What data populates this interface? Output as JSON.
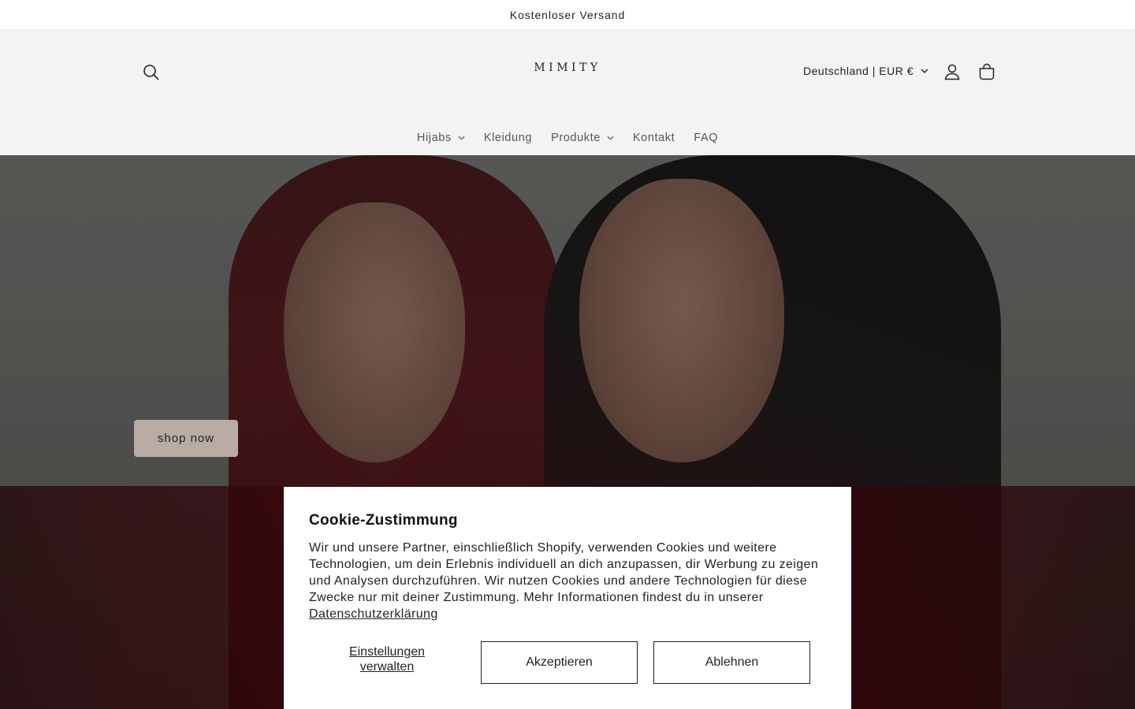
{
  "announcement": {
    "text": "Kostenloser Versand"
  },
  "header": {
    "logo": "MIMITY",
    "localization": "Deutschland | EUR €",
    "icons": {
      "search": "search-icon",
      "account": "account-icon",
      "cart": "cart-icon",
      "localization_chevron": "chevron-down-icon"
    }
  },
  "nav": {
    "items": [
      {
        "label": "Hijabs",
        "has_dropdown": true
      },
      {
        "label": "Kleidung",
        "has_dropdown": false
      },
      {
        "label": "Produkte",
        "has_dropdown": true
      },
      {
        "label": "Kontakt",
        "has_dropdown": false
      },
      {
        "label": "FAQ",
        "has_dropdown": false
      }
    ]
  },
  "hero": {
    "button_label": "shop now"
  },
  "cookie": {
    "title": "Cookie-Zustimmung",
    "text": "Wir und unsere Partner, einschließlich Shopify, verwenden Cookies und weitere Technologien, um dein Erlebnis individuell an dich anzupassen, dir Werbung zu zeigen und Analysen durchzuführen. Wir nutzen Cookies und andere Technologien für diese Zwecke nur mit deiner Zustimmung. Mehr Informationen findest du in unserer ",
    "link_label": "Datenschutzerklärung",
    "manage_label": "Einstellungen verwalten",
    "accept_label": "Akzeptieren",
    "decline_label": "Ablehnen"
  },
  "colors": {
    "header_bg": "#f3f3f3",
    "button_bg": "#b8aca4",
    "text": "#121212"
  }
}
